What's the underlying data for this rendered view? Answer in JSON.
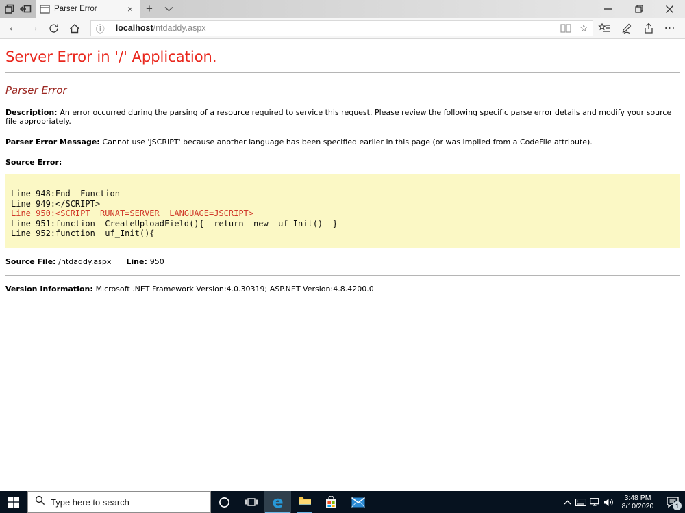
{
  "browser": {
    "tab_title": "Parser Error",
    "url_host": "localhost",
    "url_path": "/ntdaddy.aspx"
  },
  "icons": {
    "back": "←",
    "forward": "→",
    "home": "⌂",
    "info": "ⓘ",
    "favorite_star": "☆",
    "more_dots": "⋯",
    "new_tab": "+",
    "tab_close": "×",
    "window_close": "×"
  },
  "page": {
    "h1": "Server Error in '/' Application.",
    "h2": "Parser Error",
    "description_label": "Description: ",
    "description_text": "An error occurred during the parsing of a resource required to service this request. Please review the following specific parse error details and modify your source file appropriately.",
    "parser_error_label": "Parser Error Message: ",
    "parser_error_text": "Cannot use 'JSCRIPT' because another language has been specified earlier in this page (or was implied from a CodeFile attribute).",
    "source_error_label": "Source Error:",
    "code_lines": [
      {
        "text": "Line 948:End  Function",
        "error": false
      },
      {
        "text": "Line 949:</SCRIPT>",
        "error": false
      },
      {
        "text": "Line 950:<SCRIPT  RUNAT=SERVER  LANGUAGE=JSCRIPT>",
        "error": true
      },
      {
        "text": "Line 951:function  CreateUploadField(){  return  new  uf_Init()  }",
        "error": false
      },
      {
        "text": "Line 952:function  uf_Init(){",
        "error": false
      }
    ],
    "source_file_label": "Source File: ",
    "source_file_value": "/ntdaddy.aspx",
    "line_label": "Line: ",
    "line_value": "950",
    "version_label": "Version Information: ",
    "version_text": "Microsoft .NET Framework Version:4.0.30319; ASP.NET Version:4.8.4200.0"
  },
  "taskbar": {
    "search_placeholder": "Type here to search",
    "time": "3:48 PM",
    "date": "8/10/2020",
    "notification_count": "1"
  },
  "colors": {
    "error_heading": "#e9271d",
    "error_subheading": "#9b2721",
    "code_error_line": "#d03a2a",
    "source_box_bg": "#fbf8c5",
    "taskbar_bg": "#06121f",
    "taskbar_underline": "#6cb8e8",
    "edge_blue": "#2798d8"
  }
}
